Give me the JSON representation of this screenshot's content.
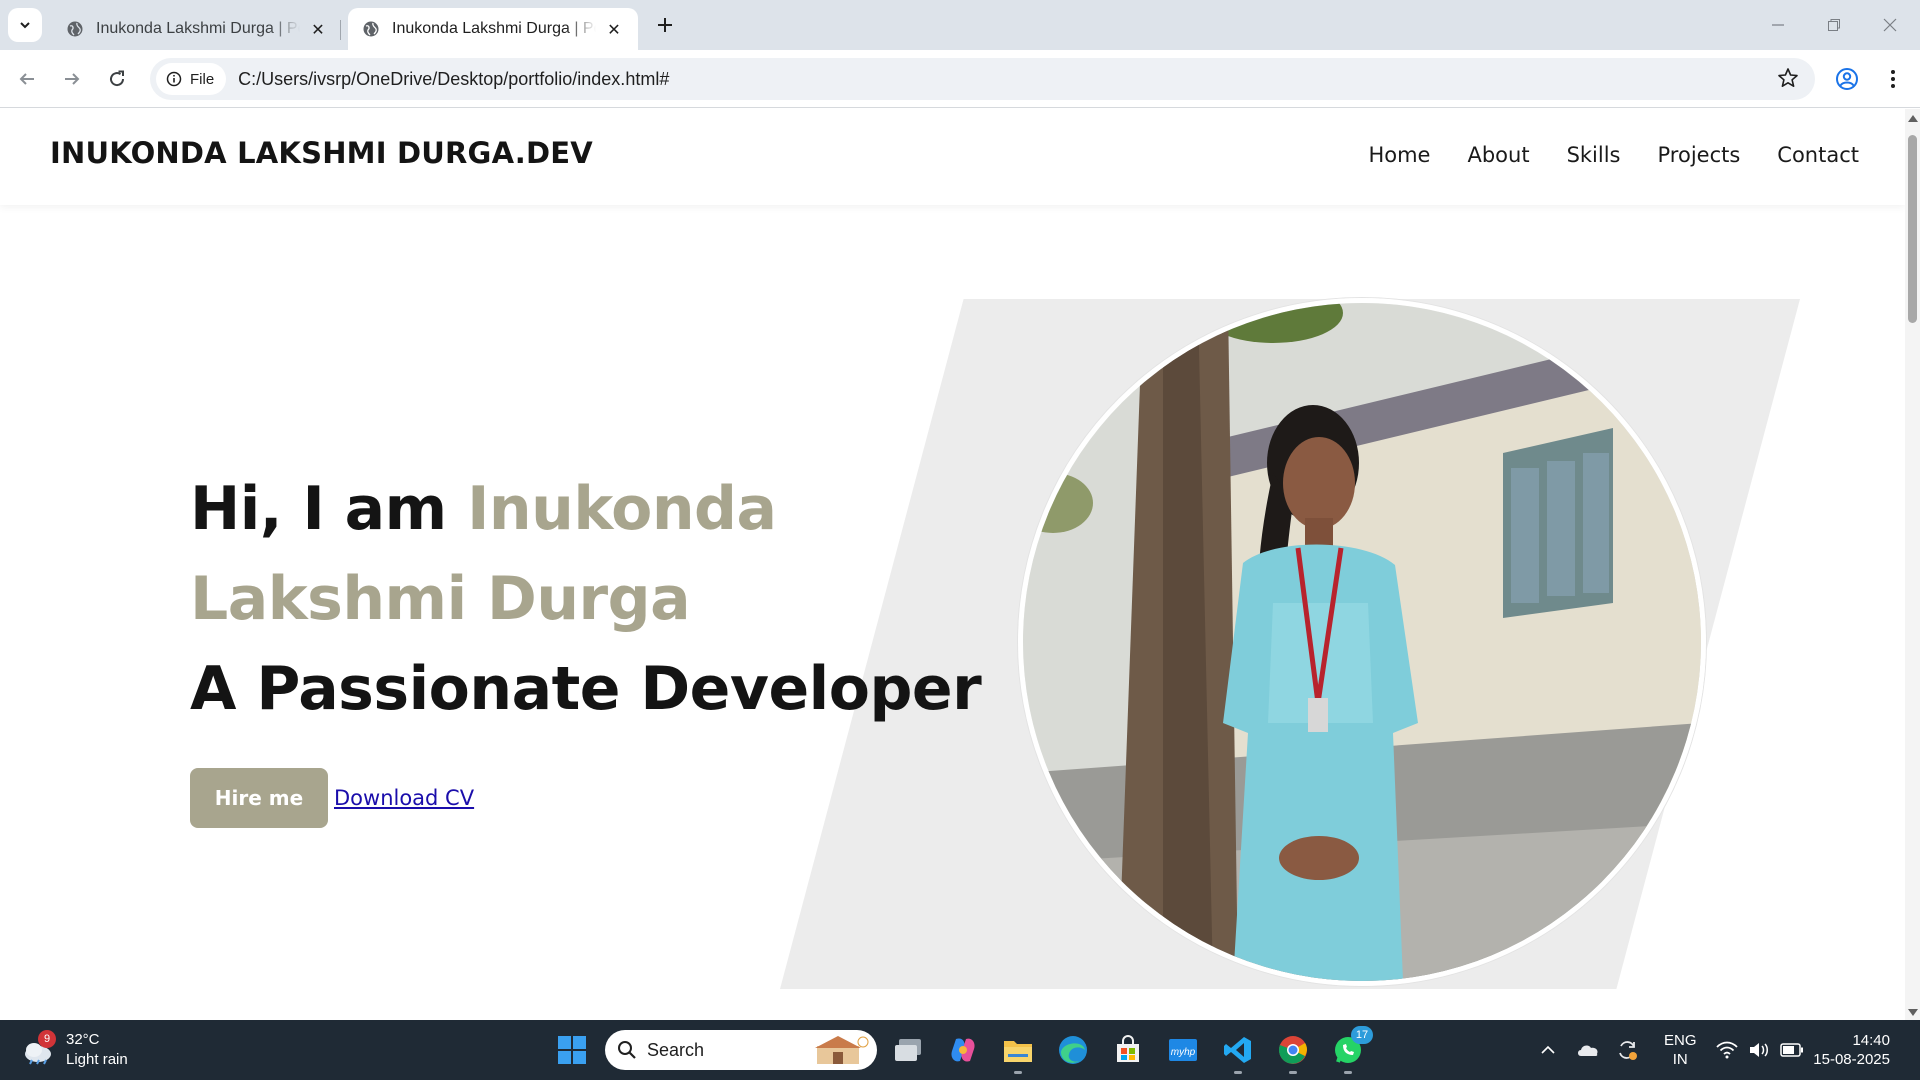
{
  "browser": {
    "tabs": [
      {
        "title": "Inukonda Lakshmi Durga | Portfolio",
        "active": false
      },
      {
        "title": "Inukonda Lakshmi Durga | Portfolio",
        "active": true
      }
    ],
    "address": {
      "scheme_chip": "File",
      "url": "C:/Users/ivsrp/OneDrive/Desktop/portfolio/index.html#"
    }
  },
  "site": {
    "logo": "INUKONDA LAKSHMI DURGA.DEV",
    "nav": [
      {
        "label": "Home"
      },
      {
        "label": "About"
      },
      {
        "label": "Skills"
      },
      {
        "label": "Projects"
      },
      {
        "label": "Contact"
      }
    ],
    "hero": {
      "greeting": "Hi, I am ",
      "name": "Inukonda Lakshmi Durga",
      "tagline": "A Passionate Developer",
      "hire_label": "Hire me",
      "cv_label": "Download CV"
    },
    "colors": {
      "accent": "#a8a58e",
      "text": "#141414",
      "panel": "#ececec"
    }
  },
  "taskbar": {
    "weather": {
      "temp": "32°C",
      "condition": "Light rain",
      "badge": "9"
    },
    "search_placeholder": "Search",
    "apps": [
      "task-view",
      "copilot",
      "file-explorer",
      "edge",
      "microsoft-store",
      "myhp",
      "vscode",
      "chrome",
      "whatsapp"
    ],
    "whatsapp_badge": "17",
    "lang": {
      "line1": "ENG",
      "line2": "IN"
    },
    "clock": {
      "time": "14:40",
      "date": "15-08-2025"
    }
  }
}
